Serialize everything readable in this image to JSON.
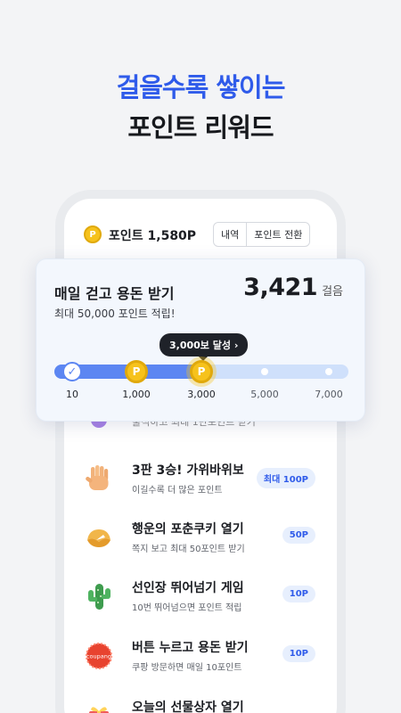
{
  "headline": {
    "line1": "걸을수록 쌓이는",
    "line2": "포인트 리워드"
  },
  "topbar": {
    "coin_glyph": "P",
    "points_text": "포인트 1,580P",
    "history_label": "내역",
    "convert_label": "포인트 전환"
  },
  "walk_card": {
    "title": "매일 걷고 용돈 받기",
    "subtitle": "최대 50,000 포인트 적립!",
    "steps_value": "3,421",
    "steps_unit": "걸음",
    "tooltip": "3,000보 달성 ›",
    "progress_fraction": 0.5,
    "milestones": [
      "10",
      "1,000",
      "3,000",
      "5,000",
      "7,000"
    ],
    "check_glyph": "✓",
    "coin_glyph": "P"
  },
  "partial_item": {
    "title": "출석하고 최대 1만포인트 받기"
  },
  "items": [
    {
      "title": "3판 3승! 가위바위보",
      "desc": "이길수록 더 많은 포인트",
      "badge": "최대 100P",
      "icon": "hand-icon"
    },
    {
      "title": "행운의 포춘쿠키 열기",
      "desc": "쪽지 보고 최대 50포인트 받기",
      "badge": "50P",
      "icon": "fortune-cookie-icon"
    },
    {
      "title": "선인장 뛰어넘기 게임",
      "desc": "10번 뛰어넘으면 포인트 적립",
      "badge": "10P",
      "icon": "cactus-icon"
    },
    {
      "title": "버튼 누르고 용돈 받기",
      "desc": "쿠팡 방문하면 매일 10포인트",
      "badge": "10P",
      "icon": "coupang-icon",
      "icon_text": "coupang"
    },
    {
      "title": "오늘의 선물상자 열기",
      "desc": "",
      "badge": "",
      "icon": "gift-box-icon"
    }
  ]
}
